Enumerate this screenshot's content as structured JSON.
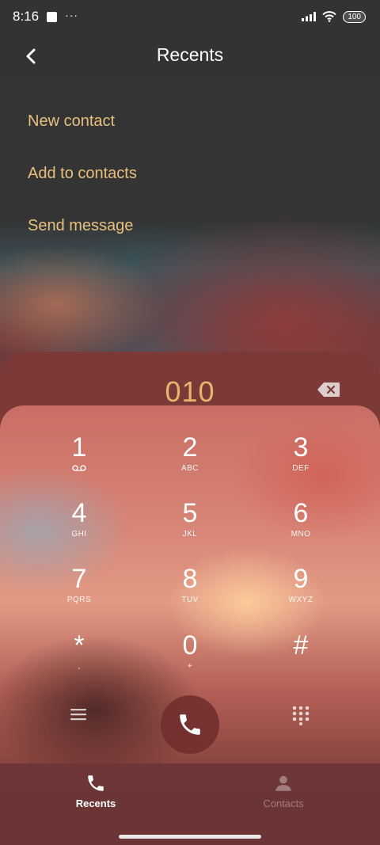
{
  "status_bar": {
    "time": "8:16",
    "overflow": "···",
    "battery": "100"
  },
  "header": {
    "title": "Recents",
    "back_icon": "chevron-left-icon"
  },
  "menu": [
    {
      "label": "New contact"
    },
    {
      "label": "Add to contacts"
    },
    {
      "label": "Send message"
    }
  ],
  "dialer": {
    "number": "010",
    "keys": [
      {
        "digit": "1",
        "letters": ""
      },
      {
        "digit": "2",
        "letters": "ABC"
      },
      {
        "digit": "3",
        "letters": "DEF"
      },
      {
        "digit": "4",
        "letters": "GHI"
      },
      {
        "digit": "5",
        "letters": "JKL"
      },
      {
        "digit": "6",
        "letters": "MNO"
      },
      {
        "digit": "7",
        "letters": "PQRS"
      },
      {
        "digit": "8",
        "letters": "TUV"
      },
      {
        "digit": "9",
        "letters": "WXYZ"
      },
      {
        "digit": "*",
        "letters": ","
      },
      {
        "digit": "0",
        "letters": "+"
      },
      {
        "digit": "#",
        "letters": ""
      }
    ]
  },
  "bottom_nav": {
    "recents_label": "Recents",
    "contacts_label": "Contacts",
    "active_tab": "Recents"
  },
  "colors": {
    "accent": "#e8c07e",
    "dialed_number": "#e8b46e",
    "call_button_bg": "#6e2d2d"
  }
}
